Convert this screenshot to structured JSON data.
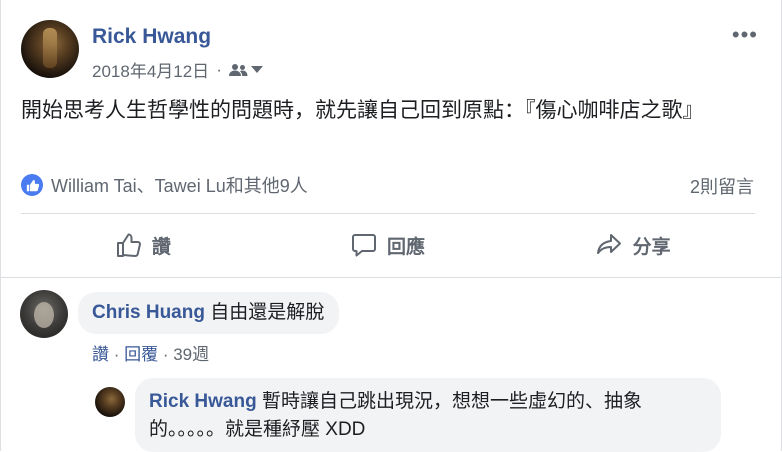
{
  "post": {
    "author": "Rick Hwang",
    "date": "2018年4月12日",
    "separator": "·",
    "audience_icon": "friends-icon",
    "more": "•••",
    "text": "開始思考人生哲學性的問題時，就先讓自己回到原點：『傷心咖啡店之歌』",
    "reactions_text": "William Tai、Tawei Lu和其他9人",
    "comments_count": "2則留言"
  },
  "actions": {
    "like": "讚",
    "comment": "回應",
    "share": "分享"
  },
  "comments": [
    {
      "author": "Chris Huang",
      "text": "自由還是解脫",
      "like": "讚",
      "reply": "回覆",
      "time": "39週",
      "sep": " · "
    }
  ],
  "replies": [
    {
      "author": "Rick Hwang",
      "text": "暫時讓自己跳出現況，想想一些虛幻的、抽象的。。。。。就是種紓壓 XDD"
    }
  ],
  "colors": {
    "link": "#385898",
    "secondary_text": "#606770",
    "bubble": "#f2f3f5",
    "like_badge": "#4a7bf0"
  }
}
